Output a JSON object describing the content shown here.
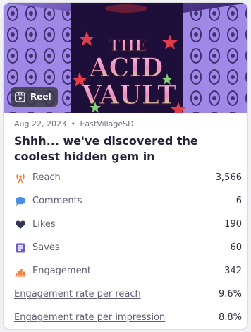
{
  "post": {
    "badge_label": "Reel",
    "date": "Aug 22, 2023",
    "separator": "•",
    "account": "EastVillageSD",
    "caption": "Shhh... we've discovered the coolest hidden gem in #EastVillageSD! 🍸...",
    "thumbnail_text": [
      "THE",
      "ACID",
      "VAULT"
    ]
  },
  "metrics": [
    {
      "icon": "reach-icon",
      "label": "Reach",
      "value": "3,566",
      "color": "#f07a33"
    },
    {
      "icon": "comment-icon",
      "label": "Comments",
      "value": "6",
      "color": "#4a8fe0"
    },
    {
      "icon": "heart-icon",
      "label": "Likes",
      "value": "190",
      "color": "#2f3455"
    },
    {
      "icon": "saves-icon",
      "label": "Saves",
      "value": "60",
      "color": "#6c5bd4"
    },
    {
      "icon": "engagement-icon",
      "label": "Engagement",
      "value": "342",
      "color": "#f07a33"
    }
  ],
  "rates": [
    {
      "label": "Engagement rate per reach",
      "value": "9.6%"
    },
    {
      "label": "Engagement rate per impression",
      "value": "8.8%"
    }
  ]
}
